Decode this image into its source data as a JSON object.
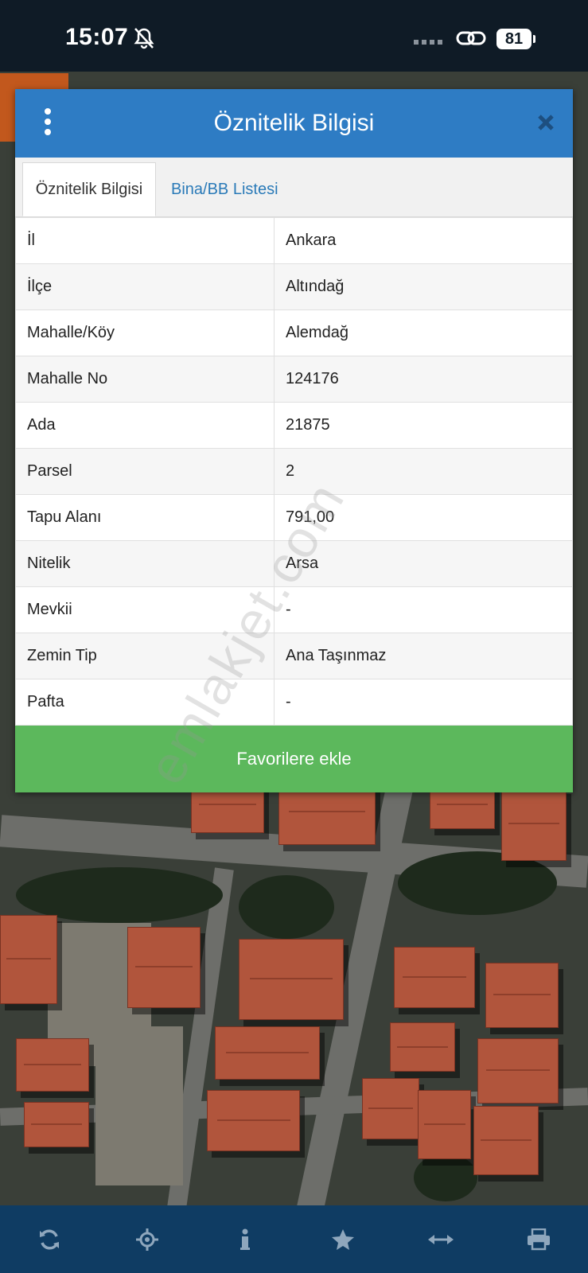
{
  "status_bar": {
    "time": "15:07",
    "battery": "81"
  },
  "dialog": {
    "title": "Öznitelik Bilgisi",
    "tabs": [
      {
        "label": "Öznitelik Bilgisi",
        "active": true
      },
      {
        "label": "Bina/BB Listesi",
        "active": false
      }
    ],
    "rows": [
      {
        "key": "İl",
        "value": "Ankara"
      },
      {
        "key": "İlçe",
        "value": "Altındağ"
      },
      {
        "key": "Mahalle/Köy",
        "value": "Alemdağ"
      },
      {
        "key": "Mahalle No",
        "value": "124176"
      },
      {
        "key": "Ada",
        "value": "21875"
      },
      {
        "key": "Parsel",
        "value": "2"
      },
      {
        "key": "Tapu Alanı",
        "value": "791,00"
      },
      {
        "key": "Nitelik",
        "value": "Arsa"
      },
      {
        "key": "Mevkii",
        "value": "-"
      },
      {
        "key": "Zemin Tip",
        "value": "Ana Taşınmaz"
      },
      {
        "key": "Pafta",
        "value": "-"
      }
    ],
    "favorite_label": "Favorilere ekle"
  },
  "watermark": "emlakjet.com",
  "toolbar": {
    "icons": [
      "refresh-icon",
      "locate-icon",
      "info-icon",
      "star-icon",
      "measure-icon",
      "print-icon"
    ]
  },
  "colors": {
    "header": "#2e7cc4",
    "favorite": "#5cb85c",
    "toolbar": "#0f3c63",
    "status_bar": "#0f1b26"
  }
}
